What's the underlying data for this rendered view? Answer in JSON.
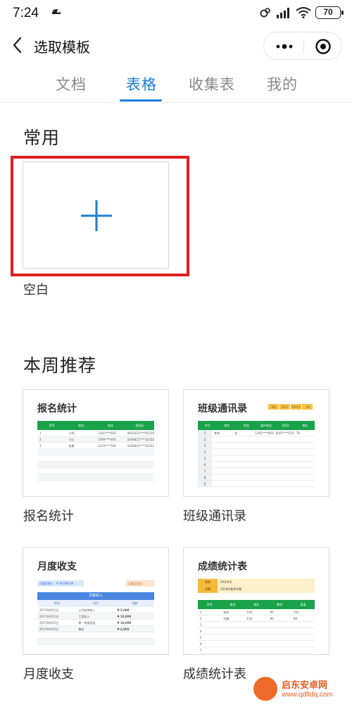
{
  "status_bar": {
    "time": "7:24",
    "battery": "70",
    "icons": [
      "notification-icon",
      "link-icon",
      "signal-icon",
      "wifi-icon",
      "battery-icon"
    ]
  },
  "nav": {
    "title": "选取模板",
    "back_icon": "chevron-left-icon",
    "capsule_icons": [
      "more-icon",
      "close-circle-icon"
    ]
  },
  "tabs": [
    {
      "label": "文档",
      "active": false
    },
    {
      "label": "表格",
      "active": true
    },
    {
      "label": "收集表",
      "active": false
    },
    {
      "label": "我的",
      "active": false
    }
  ],
  "colors": {
    "accent": "#1a7fd6",
    "highlight": "#e01f1f",
    "sheet_green": "#1aa24a",
    "sheet_blue": "#4a86e0"
  },
  "common": {
    "title": "常用",
    "blank_label": "空白"
  },
  "weekly": {
    "title": "本周推荐",
    "templates": [
      {
        "label": "报名统计",
        "preview_title": "报名统计",
        "headers": [
          "序号",
          "姓名",
          "电话",
          "身份证"
        ],
        "rows": [
          [
            "1",
            "小明",
            "1381****602",
            "4401022****9125035"
          ],
          [
            "2",
            "小红",
            "1599****650",
            "3206821****3232208"
          ],
          [
            "3",
            "张勇",
            "1325****764",
            "3206821****5232208"
          ]
        ]
      },
      {
        "label": "班级通讯录",
        "preview_title": "班级通讯录",
        "legend": [
          "班级",
          "班主任",
          "联系方式",
          "人数"
        ],
        "headers": [
          "学号",
          "姓名",
          "性别",
          "监护电话",
          "QQ号",
          "地址"
        ],
        "rows": [
          [
            "1",
            "李明",
            "女",
            "1361****9058",
            "8567****5231",
            "T8"
          ]
        ],
        "empty_rows": [
          "2",
          "3",
          "4",
          "5",
          "6",
          "7",
          "8",
          "9"
        ]
      },
      {
        "label": "月度收支",
        "preview_title": "月度收支",
        "summary_left": "月度总收入：¥ 29,000.00",
        "summary_right": "月度总支出",
        "table_head": "月度收入",
        "sub_headers": [
          "时间",
          "项目",
          "金额"
        ],
        "rows": [
          [
            "2017年9月1日",
            "上月结余转入",
            "¥ 5,000"
          ],
          [
            "2017年9月1日",
            "工资收入",
            "¥ 10,000"
          ],
          [
            "2017年9月2日",
            "第一季度奖励",
            "¥ 10,000"
          ],
          [
            "2017年9月5日",
            "稿金",
            "¥ 4,000"
          ]
        ]
      },
      {
        "label": "成绩统计表",
        "preview_title": "成绩统计表",
        "school": [
          {
            "key": "学校",
            "value": "XXX中学"
          },
          {
            "key": "学期",
            "value": "2018年春季学期"
          }
        ],
        "headers": [
          "学号",
          "姓名",
          "语文",
          "数学",
          "英语"
        ],
        "rows": [
          [
            "1",
            "张明",
            "108",
            "96",
            "102"
          ],
          [
            "2",
            "刘晨",
            "110",
            "90",
            "98"
          ]
        ],
        "empty_rows": [
          "3",
          "4",
          "5",
          "6",
          "7",
          "8",
          "9"
        ]
      }
    ]
  },
  "watermark": {
    "text": "启东安卓网",
    "url": "www.qdltdq.com"
  }
}
